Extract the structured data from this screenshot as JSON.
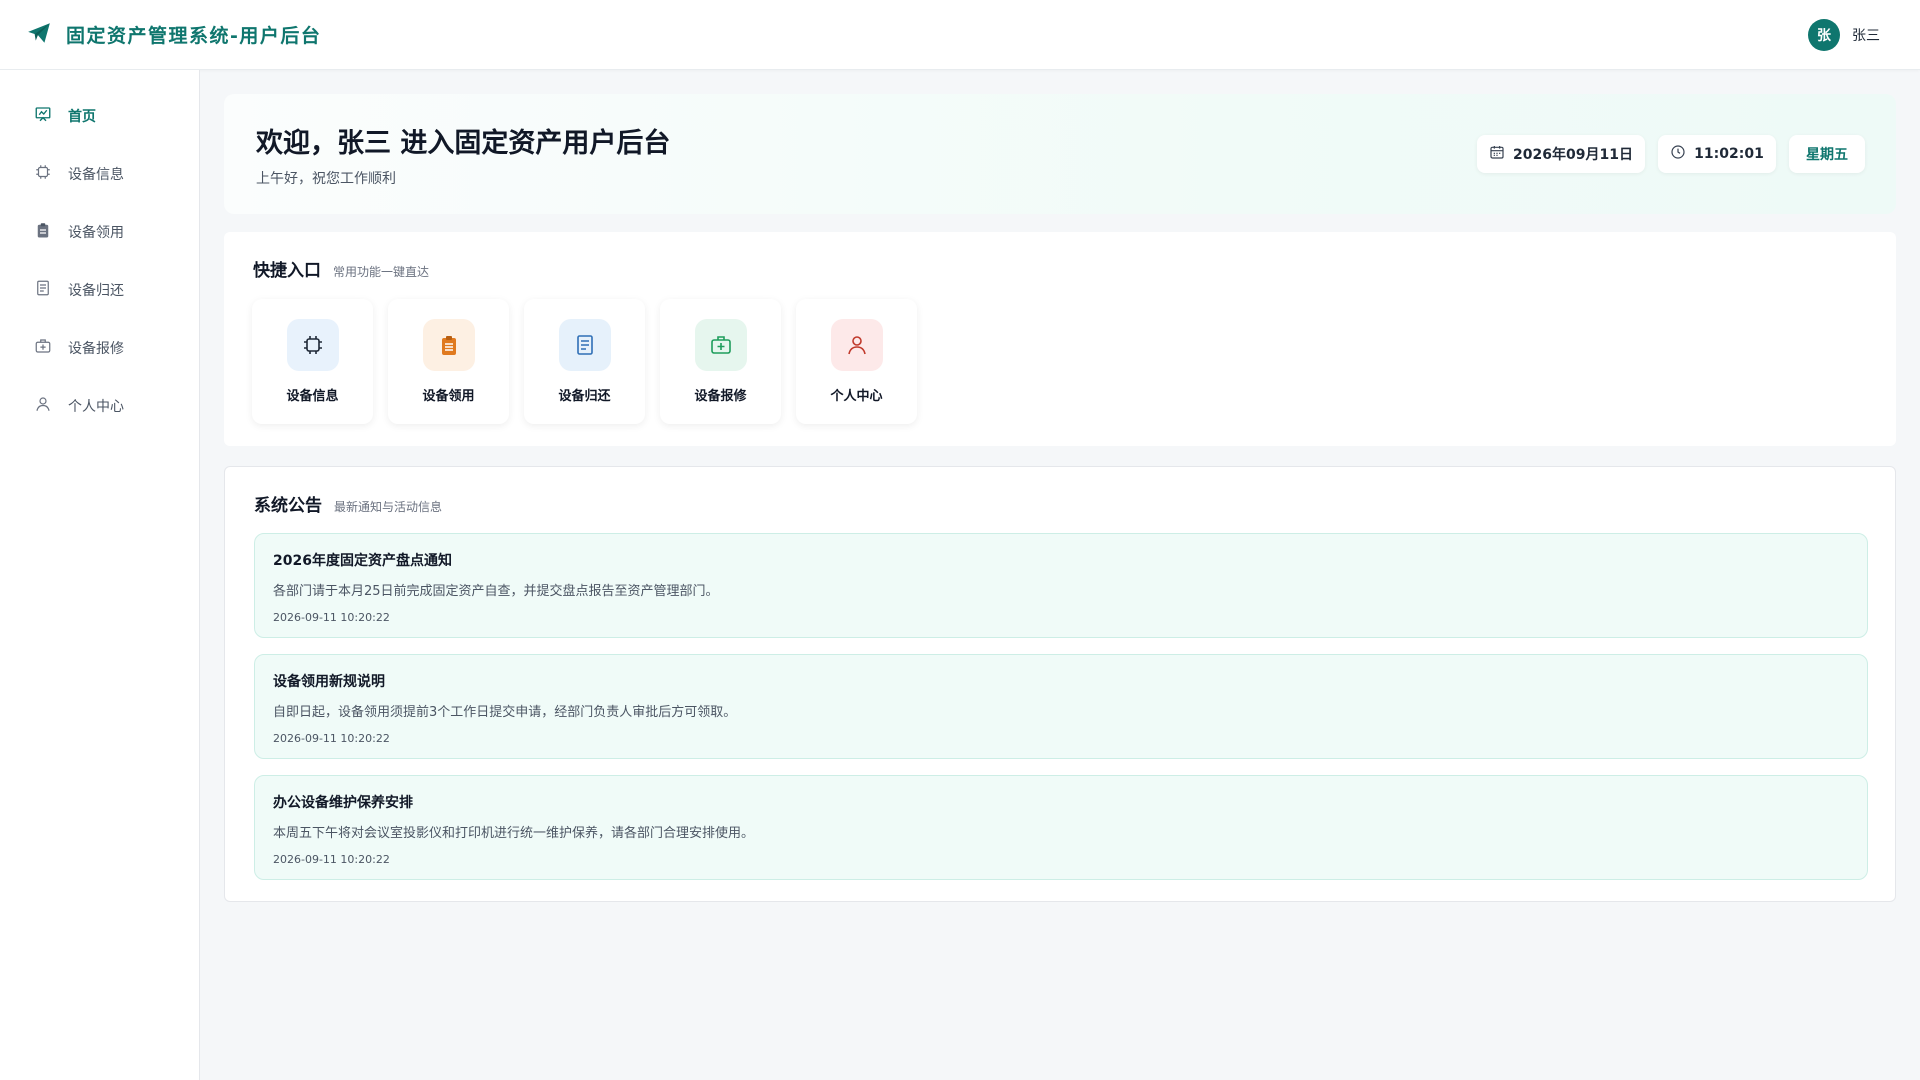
{
  "header": {
    "title": "固定资产管理系统-用户后台",
    "avatar_text": "张",
    "user_name": "张三"
  },
  "sidebar": {
    "items": [
      {
        "label": "首页",
        "icon": "chart-board-icon",
        "active": true
      },
      {
        "label": "设备信息",
        "icon": "chip-icon"
      },
      {
        "label": "设备领用",
        "icon": "clipboard-icon"
      },
      {
        "label": "设备归还",
        "icon": "document-icon"
      },
      {
        "label": "设备报修",
        "icon": "medkit-icon"
      },
      {
        "label": "个人中心",
        "icon": "user-icon"
      }
    ]
  },
  "welcome": {
    "title": "欢迎，张三 进入固定资产用户后台",
    "subtitle": "上午好，祝您工作顺利",
    "date": "2026年09月11日",
    "time": "11:02:01",
    "weekday": "星期五"
  },
  "quick": {
    "title": "快捷入口",
    "subtitle": "常用功能一键直达",
    "items": [
      {
        "label": "设备信息",
        "icon": "chip-icon"
      },
      {
        "label": "设备领用",
        "icon": "clipboard-icon"
      },
      {
        "label": "设备归还",
        "icon": "document-icon"
      },
      {
        "label": "设备报修",
        "icon": "medkit-icon"
      },
      {
        "label": "个人中心",
        "icon": "user-icon"
      }
    ]
  },
  "notices": {
    "title": "系统公告",
    "subtitle": "最新通知与活动信息",
    "items": [
      {
        "title": "2026年度固定资产盘点通知",
        "content": "各部门请于本月25日前完成固定资产自查，并提交盘点报告至资产管理部门。",
        "time": "2026-09-11 10:20:22"
      },
      {
        "title": "设备领用新规说明",
        "content": "自即日起，设备领用须提前3个工作日提交申请，经部门负责人审批后方可领取。",
        "time": "2026-09-11 10:20:22"
      },
      {
        "title": "办公设备维护保养安排",
        "content": "本周五下午将对会议室投影仪和打印机进行统一维护保养，请各部门合理安排使用。",
        "time": "2026-09-11 10:20:22"
      }
    ]
  },
  "colors": {
    "brand": "#0f766e",
    "notice_bg": "#f0fbf8"
  }
}
